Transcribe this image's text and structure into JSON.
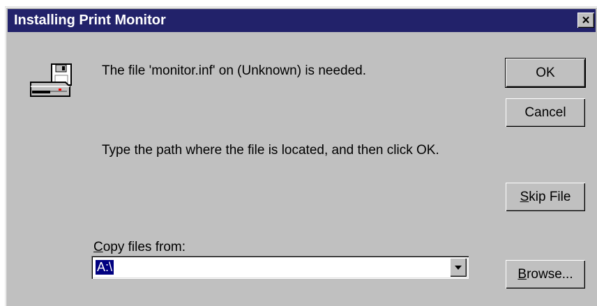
{
  "window": {
    "title": "Installing Print Monitor",
    "close_symbol": "×"
  },
  "message": "The file 'monitor.inf' on (Unknown) is needed.",
  "instruction": "Type the path where the file is located, and then click OK.",
  "copy_label": {
    "underlined": "C",
    "rest": "opy files from:"
  },
  "path_value": "A:\\",
  "buttons": {
    "ok": "OK",
    "cancel": "Cancel",
    "skip": {
      "underlined": "S",
      "rest": "kip File"
    },
    "browse": {
      "underlined": "B",
      "rest": "rowse..."
    }
  },
  "icons": {
    "disk": "floppy-disk-drive-icon",
    "dropdown": "chevron-down-icon",
    "close": "close-icon"
  }
}
